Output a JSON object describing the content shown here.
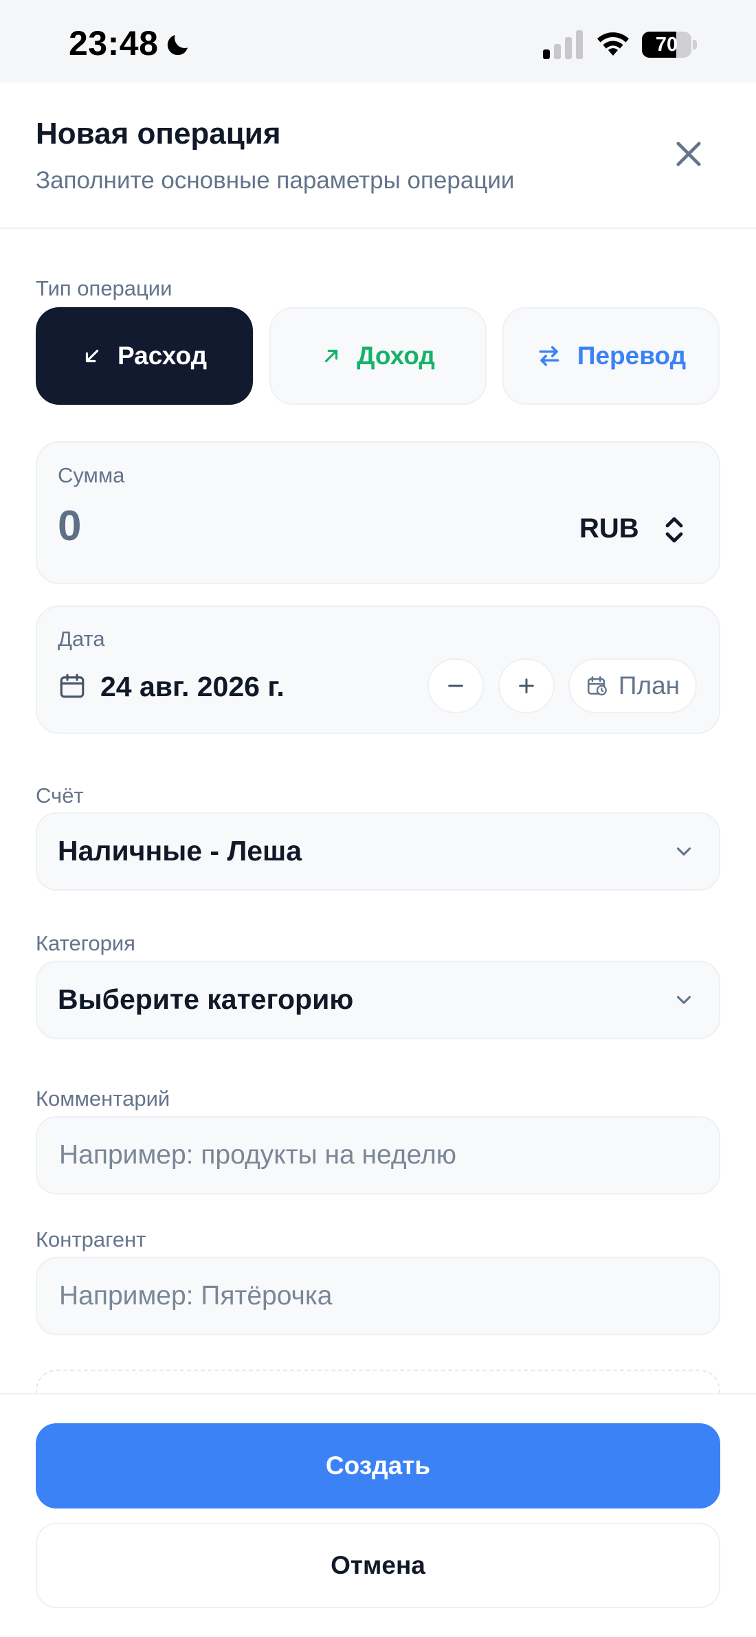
{
  "status_bar": {
    "time": "23:48",
    "battery_percent": "70",
    "battery_level": 0.7,
    "icons": [
      "moon-icon",
      "cellular-signal-icon",
      "wifi-icon",
      "battery-icon"
    ]
  },
  "header": {
    "title": "Новая операция",
    "subtitle": "Заполните основные параметры операции",
    "close_icon": "close-icon"
  },
  "operation_type": {
    "label": "Тип операции",
    "selected": "Расход",
    "options": [
      {
        "label": "Расход",
        "icon": "arrow-down-left-icon",
        "color": "#ffffff"
      },
      {
        "label": "Доход",
        "icon": "arrow-up-right-icon",
        "color": "#17b26a"
      },
      {
        "label": "Перевод",
        "icon": "transfer-arrows-icon",
        "color": "#3b82f6"
      }
    ]
  },
  "amount": {
    "label": "Сумма",
    "value": "0",
    "currency": "RUB"
  },
  "date": {
    "label": "Дата",
    "value": "24 авг. 2026 г.",
    "decrement": "−",
    "increment": "+",
    "plan_label": "План"
  },
  "account": {
    "label": "Счёт",
    "value": "Наличные - Леша"
  },
  "category": {
    "label": "Категория",
    "value": "Выберите категорию"
  },
  "comment": {
    "label": "Комментарий",
    "placeholder": "Например: продукты на неделю"
  },
  "counterparty": {
    "label": "Контрагент",
    "placeholder": "Например: Пятёрочка"
  },
  "actions": {
    "create_label": "Создать",
    "cancel_label": "Отмена"
  },
  "colors": {
    "primary": "#3b82f6",
    "dark": "#111a2e",
    "income": "#17b26a",
    "muted_text": "#64748b"
  }
}
